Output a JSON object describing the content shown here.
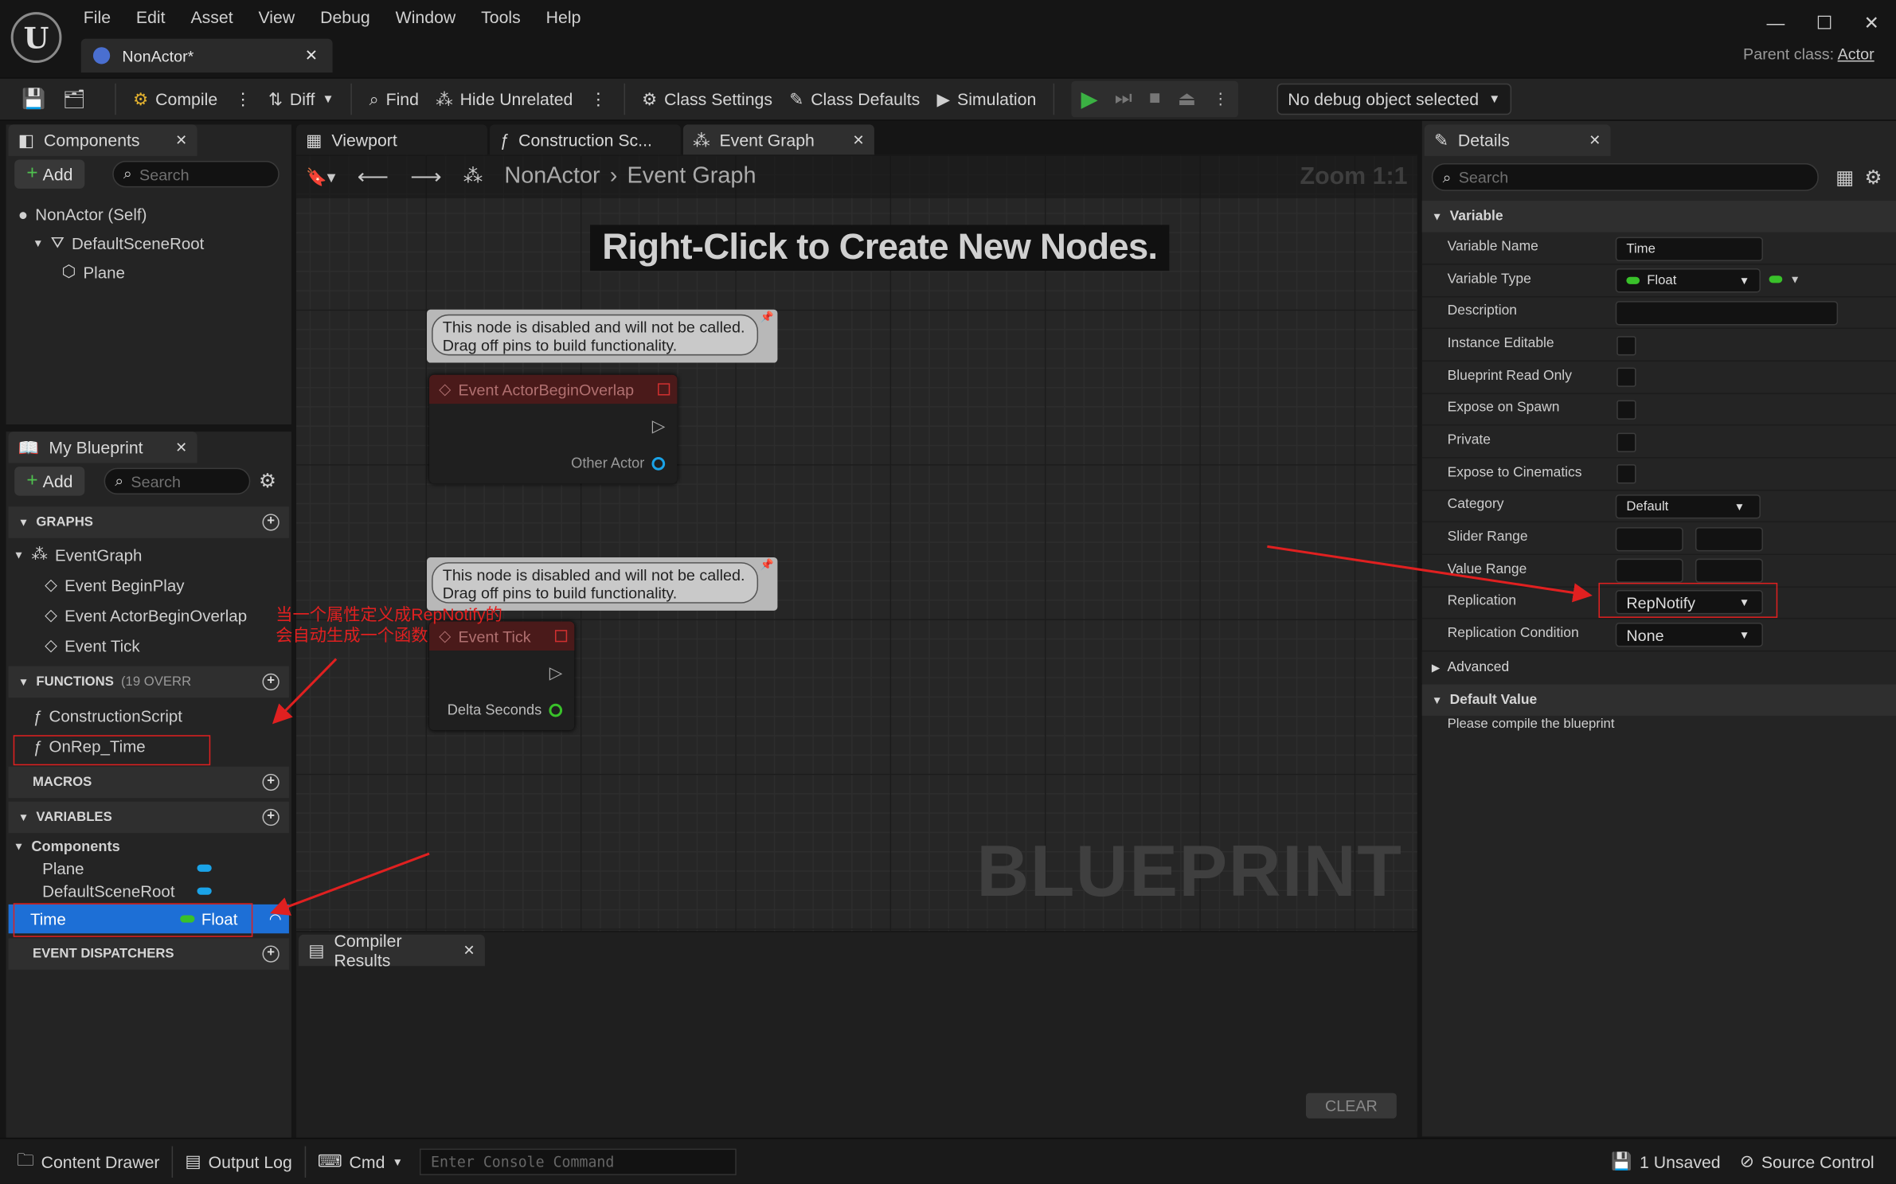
{
  "menu": {
    "items": [
      "File",
      "Edit",
      "Asset",
      "View",
      "Debug",
      "Window",
      "Tools",
      "Help"
    ],
    "doc_tab": "NonActor*",
    "parent_class_label": "Parent class:",
    "parent_class_value": "Actor"
  },
  "toolbar": {
    "compile": "Compile",
    "diff": "Diff",
    "find": "Find",
    "hide_unrelated": "Hide Unrelated",
    "class_settings": "Class Settings",
    "class_defaults": "Class Defaults",
    "simulation": "Simulation",
    "debug_object": "No debug object selected"
  },
  "components_panel": {
    "tab": "Components",
    "add": "Add",
    "search_placeholder": "Search",
    "tree": [
      "NonActor (Self)",
      "DefaultSceneRoot",
      "Plane"
    ]
  },
  "my_blueprint": {
    "tab": "My Blueprint",
    "add": "Add",
    "search_placeholder": "Search",
    "graphs_header": "GRAPHS",
    "event_graph": "EventGraph",
    "events": [
      "Event BeginPlay",
      "Event ActorBeginOverlap",
      "Event Tick"
    ],
    "functions_header": "FUNCTIONS",
    "functions_override": "(19 OVERR",
    "functions": [
      "ConstructionScript",
      "OnRep_Time"
    ],
    "macros_header": "MACROS",
    "variables_header": "VARIABLES",
    "components_group": "Components",
    "component_vars": [
      "Plane",
      "DefaultSceneRoot"
    ],
    "time_var": "Time",
    "time_type": "Float",
    "dispatchers_header": "EVENT DISPATCHERS"
  },
  "editor_tabs": {
    "viewport": "Viewport",
    "construction": "Construction Sc...",
    "event_graph": "Event Graph"
  },
  "graph": {
    "breadcrumb_root": "NonActor",
    "breadcrumb_leaf": "Event Graph",
    "zoom": "Zoom 1:1",
    "hint": "Right-Click to Create New Nodes.",
    "comment_line1": "This node is disabled and will not be called.",
    "comment_line2": "Drag off pins to build functionality.",
    "node1_title": "Event ActorBeginOverlap",
    "node1_pin": "Other Actor",
    "node2_title": "Event Tick",
    "node2_pin": "Delta Seconds",
    "watermark": "BLUEPRINT"
  },
  "annotation": {
    "line1": "当一个属性定义成RepNotify的",
    "line2": "会自动生成一个函数"
  },
  "compiler": {
    "tab": "Compiler Results",
    "clear": "CLEAR"
  },
  "details": {
    "tab": "Details",
    "search_placeholder": "Search",
    "variable_section": "Variable",
    "rows": {
      "variable_name": "Variable Name",
      "variable_type": "Variable Type",
      "description": "Description",
      "instance_editable": "Instance Editable",
      "blueprint_read_only": "Blueprint Read Only",
      "expose_on_spawn": "Expose on Spawn",
      "private": "Private",
      "expose_to_cinematics": "Expose to Cinematics",
      "category": "Category",
      "slider_range": "Slider Range",
      "value_range": "Value Range",
      "replication": "Replication",
      "replication_condition": "Replication Condition"
    },
    "values": {
      "variable_name": "Time",
      "variable_type": "Float",
      "category": "Default",
      "replication": "RepNotify",
      "replication_condition": "None"
    },
    "advanced": "Advanced",
    "default_value_section": "Default Value",
    "default_value_msg": "Please compile the blueprint"
  },
  "statusbar": {
    "content_drawer": "Content Drawer",
    "output_log": "Output Log",
    "cmd": "Cmd",
    "console_placeholder": "Enter Console Command",
    "unsaved": "1 Unsaved",
    "source_control": "Source Control"
  },
  "colors": {
    "float_pin": "#39c12a",
    "object_pin": "#1aa3e8",
    "annotation_red": "#e02020",
    "play_green": "#3bb143"
  }
}
